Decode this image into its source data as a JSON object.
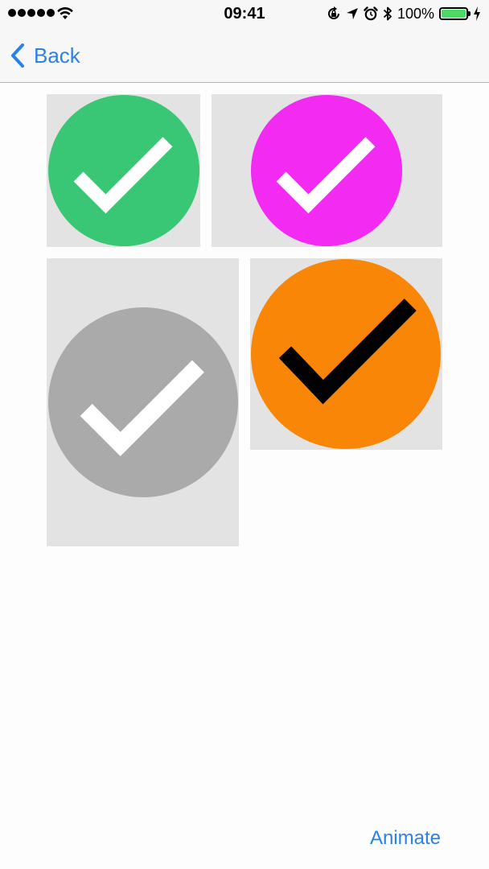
{
  "status_bar": {
    "time": "09:41",
    "battery_percent_text": "100%",
    "battery_level": 1.0,
    "signal_bars": 5,
    "icons": [
      "signal-icon",
      "wifi-icon",
      "orientation-lock-icon",
      "location-arrow-icon",
      "alarm-icon",
      "bluetooth-icon",
      "battery-icon",
      "charging-bolt-icon"
    ]
  },
  "nav": {
    "back_label": "Back",
    "back_icon": "chevron-left-icon"
  },
  "tiles": [
    {
      "name": "tile-green-check",
      "circle_color": "#3ac775",
      "check_color": "#ffffff",
      "icon": "checkmark-icon"
    },
    {
      "name": "tile-magenta-check",
      "circle_color": "#f22af2",
      "check_color": "#ffffff",
      "icon": "checkmark-icon"
    },
    {
      "name": "tile-gray-check",
      "circle_color": "#aaaaaa",
      "check_color": "#ffffff",
      "icon": "checkmark-icon"
    },
    {
      "name": "tile-orange-check",
      "circle_color": "#fa8608",
      "check_color": "#000000",
      "icon": "checkmark-icon"
    }
  ],
  "colors": {
    "accent": "#2b82e6",
    "tile_background": "#e3e3e3",
    "battery_fill": "#4cd964"
  },
  "footer": {
    "animate_label": "Animate"
  }
}
